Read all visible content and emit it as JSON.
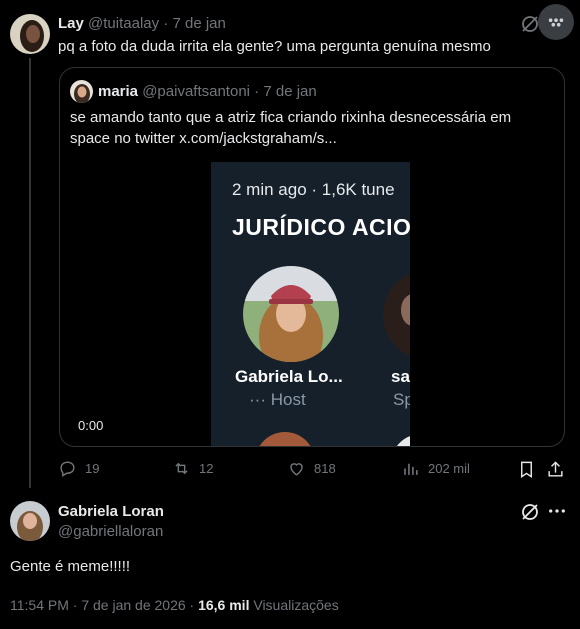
{
  "main_tweet": {
    "display_name": "Lay",
    "handle": "@tuitaalay",
    "date": "7 de jan",
    "text": "pq a foto da duda irrita ela gente? uma pergunta genuína mesmo"
  },
  "quote": {
    "display_name": "maria",
    "handle": "@paivaftsantoni",
    "date": "7 de jan",
    "text_line1": "se amando tanto que a atriz fica criando rixinha desnecessária em",
    "text_line2": "space no twitter  x.com/jackstgraham/s...",
    "video_time": "0:00",
    "media": {
      "meta": "2 min ago · 1,6K tune",
      "title": "JURÍDICO ACIO",
      "host_name": "Gabriela Lo...",
      "host_role": "··· Host",
      "speaker_name": "sa",
      "speaker_role": "Sp"
    }
  },
  "actions": {
    "replies": "19",
    "retweets": "12",
    "likes": "818",
    "views": "202 mil"
  },
  "reply": {
    "display_name": "Gabriela Loran",
    "handle": "@gabriellaloran",
    "text": "Gente é meme!!!!!",
    "time": "11:54 PM · 7 de jan de 2026 · ",
    "views_count": "16,6 mil",
    "views_label": " Visualizações"
  },
  "colors": {
    "background": "#000000",
    "text": "#e7e9ea",
    "muted": "#71767b",
    "border": "#2f3336",
    "media_bg": "#15202b",
    "host_accent": "#8b7cf6"
  }
}
